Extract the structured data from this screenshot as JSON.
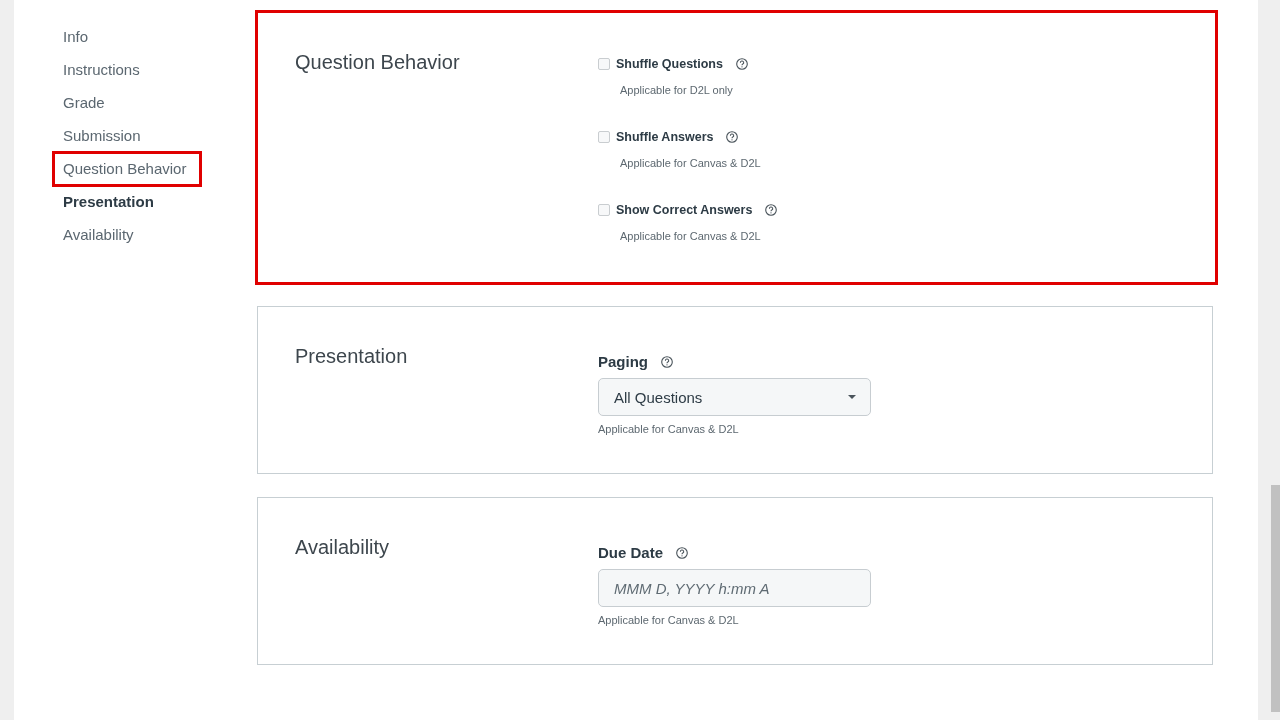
{
  "sidebar": {
    "items": [
      {
        "label": "Info",
        "selected": false,
        "highlighted": false
      },
      {
        "label": "Instructions",
        "selected": false,
        "highlighted": false
      },
      {
        "label": "Grade",
        "selected": false,
        "highlighted": false
      },
      {
        "label": "Submission",
        "selected": false,
        "highlighted": false
      },
      {
        "label": "Question Behavior",
        "selected": false,
        "highlighted": true
      },
      {
        "label": "Presentation",
        "selected": true,
        "highlighted": false
      },
      {
        "label": "Availability",
        "selected": false,
        "highlighted": false
      }
    ]
  },
  "sections": [
    {
      "title": "Question Behavior",
      "highlighted": true,
      "kind": "checkboxes",
      "options": [
        {
          "label": "Shuffle Questions",
          "checked": false,
          "hint": "Applicable for D2L only"
        },
        {
          "label": "Shuffle Answers",
          "checked": false,
          "hint": "Applicable for Canvas & D2L"
        },
        {
          "label": "Show Correct Answers",
          "checked": false,
          "hint": "Applicable for Canvas & D2L"
        }
      ]
    },
    {
      "title": "Presentation",
      "highlighted": false,
      "kind": "dropdown",
      "field": {
        "label": "Paging",
        "value": "All Questions",
        "hint": "Applicable for Canvas & D2L"
      }
    },
    {
      "title": "Availability",
      "highlighted": false,
      "kind": "date",
      "field": {
        "label": "Due Date",
        "placeholder": "MMM D, YYYY h:mm A",
        "hint": "Applicable for Canvas & D2L"
      }
    }
  ]
}
